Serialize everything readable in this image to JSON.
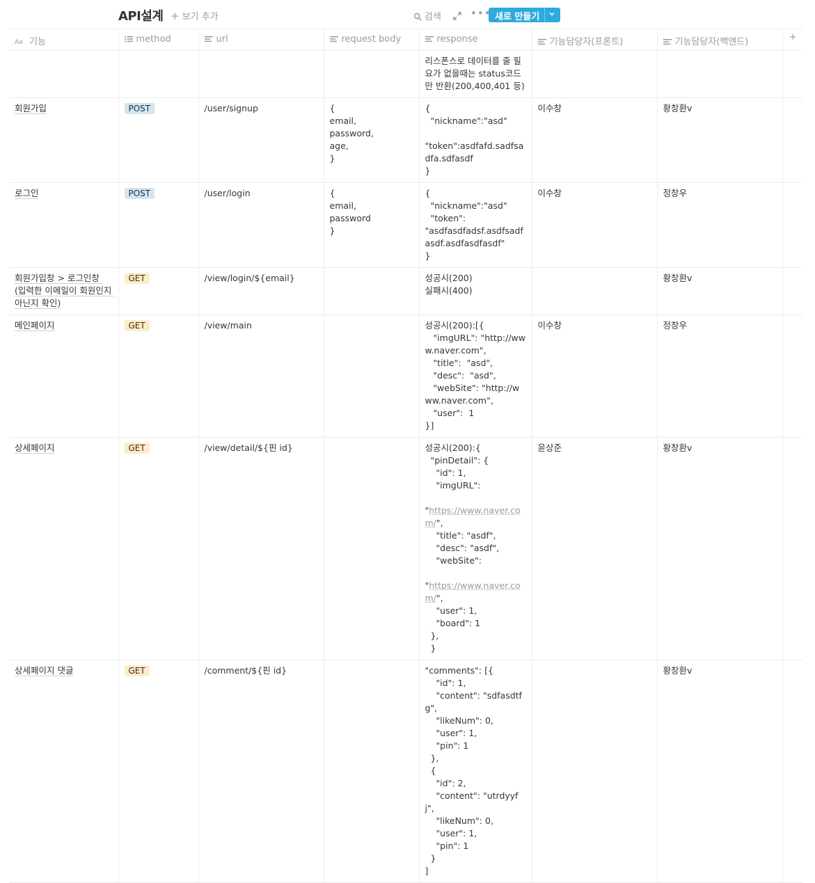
{
  "header": {
    "title": "API설계",
    "add_view_label": "보기 추가",
    "search_label": "검색",
    "new_button_label": "새로 만들기"
  },
  "columns": [
    {
      "label": "기능",
      "icon": "title-icon"
    },
    {
      "label": "method",
      "icon": "list-icon"
    },
    {
      "label": "url",
      "icon": "text-icon"
    },
    {
      "label": "request body",
      "icon": "text-icon"
    },
    {
      "label": "response",
      "icon": "text-icon"
    },
    {
      "label": "기능담당자(프론트)",
      "icon": "text-icon"
    },
    {
      "label": "기능담당자(백엔드)",
      "icon": "text-icon"
    }
  ],
  "method_colors": {
    "POST": "#d3e5ef",
    "GET": "#fdecc8"
  },
  "rows": [
    {
      "feature": "",
      "method": "",
      "url": "",
      "request_body": "",
      "response": "리스폰스로 데이터를 줄 필요가 없을때는 status코드만 반환(200,400,401 등)",
      "frontend": "",
      "backend": ""
    },
    {
      "feature": "회원가입",
      "method": "POST",
      "url": "/user/signup",
      "request_body": "{\nemail,\npassword,\nage,\n}",
      "response": "{\n  \"nickname\":\"asd\"\n\n\"token\":asdfafd.sadfsadfa.sdfasdf\n}",
      "frontend": "이수창",
      "backend": "황창환v"
    },
    {
      "feature": "로그인",
      "method": "POST",
      "url": "/user/login",
      "request_body": "{\nemail,\npassword\n}",
      "response": "{\n  \"nickname\":\"asd\"\n  \"token\":\n\"asdfasdfadsf.asdfsadfasdf.asdfasdfasdf\"\n}",
      "frontend": "이수창",
      "backend": "정창우"
    },
    {
      "feature": "회원가입창 > 로그인창 (입력한 이메일이 회원인지 아닌지 확인)",
      "method": "GET",
      "url": "/view/login/${email}",
      "request_body": "",
      "response": "성공시(200)\n실패시(400)",
      "frontend": "",
      "backend": "황창환v"
    },
    {
      "feature": "메인페이지",
      "method": "GET",
      "url": "/view/main",
      "request_body": "",
      "response": "성공시(200):[{\n   \"imgURL\": \"http://www.naver.com\",\n   \"title\":  \"asd\",\n   \"desc\":  \"asd\",\n   \"webSite\": \"http://www.naver.com\",\n   \"user\":  1\n}]",
      "frontend": "이수창",
      "backend": "정창우"
    },
    {
      "feature": "상세페이지",
      "method": "GET",
      "url": "/view/detail/${핀 id}",
      "request_body": "",
      "response_parts": [
        "성공시(200):{\n  \"pinDetail\": {\n    \"id\": 1,\n    \"imgURL\":\n\n\"",
        "https://www.naver.com/",
        "\",\n    \"title\": \"asdf\",\n    \"desc\": \"asdf\",\n    \"webSite\":\n\n\"",
        "https://www.naver.com/",
        "\",\n    \"user\": 1,\n    \"board\": 1\n  },\n  }"
      ],
      "frontend": "윤상준",
      "backend": "황창환v"
    },
    {
      "feature": "상세페이지 댓글",
      "method": "GET",
      "url": "/comment/${핀 id}",
      "request_body": "",
      "response": "\"comments\": [{\n    \"id\": 1,\n    \"content\": \"sdfasdtfg\",\n    \"likeNum\": 0,\n    \"user\": 1,\n    \"pin\": 1\n  },\n  {\n    \"id\": 2,\n    \"content\": \"utrdyyfj\",\n    \"likeNum\": 0,\n    \"user\": 1,\n    \"pin\": 1\n  }\n]",
      "frontend": "",
      "backend": "황창환v"
    }
  ]
}
